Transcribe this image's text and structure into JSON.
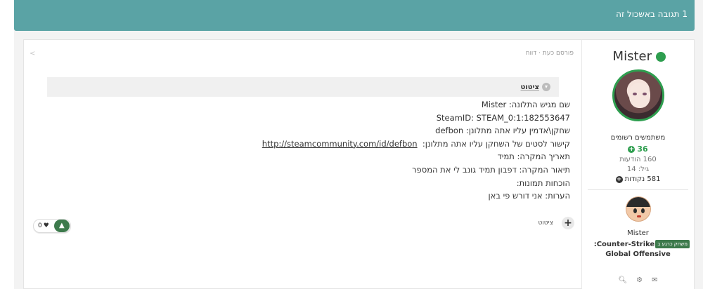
{
  "header": {
    "title": "1 תגובה באשכול זה"
  },
  "author": {
    "name": "Mister",
    "group": "משתמשים רשומים",
    "reputation": "36",
    "posts": "160 הודעות",
    "age": "גיל: 14",
    "points": "581 נקודות",
    "game_user": "Mister",
    "game_badge": "משחק כרגע ב",
    "game_name_line1": "Counter-Strike:",
    "game_name_line2": "Global Offensive",
    "icons": [
      "search-icon",
      "steam-icon",
      "envelope-icon"
    ]
  },
  "post": {
    "meta_posted": "פורסם כעת",
    "meta_separator": " · ",
    "meta_report": "דווח",
    "quote_label": "ציטוט",
    "lines": [
      "שם מגיש התלונה: Mister",
      "SteamID: STEAM_0:1:182553647",
      "שחקן\\אדמין עליו אתה מתלונן: defbon",
      "קישור לסטים של השחקן עליו אתה מתלונן:",
      "תאריך המקרה: תמיד",
      "תיאור המקרה: דפבון תמיד גונב לי את המספר",
      "הוכחות תמונות:",
      "הערות: אני דורש פי באן"
    ],
    "link_url": "http://steamcommunity.com/id/defbon",
    "like_count": "0",
    "footer_quote": "ציטוט"
  },
  "colors": {
    "header": "#5aa3a5",
    "online": "#2e9e4f",
    "badge": "#3d7a4c"
  }
}
